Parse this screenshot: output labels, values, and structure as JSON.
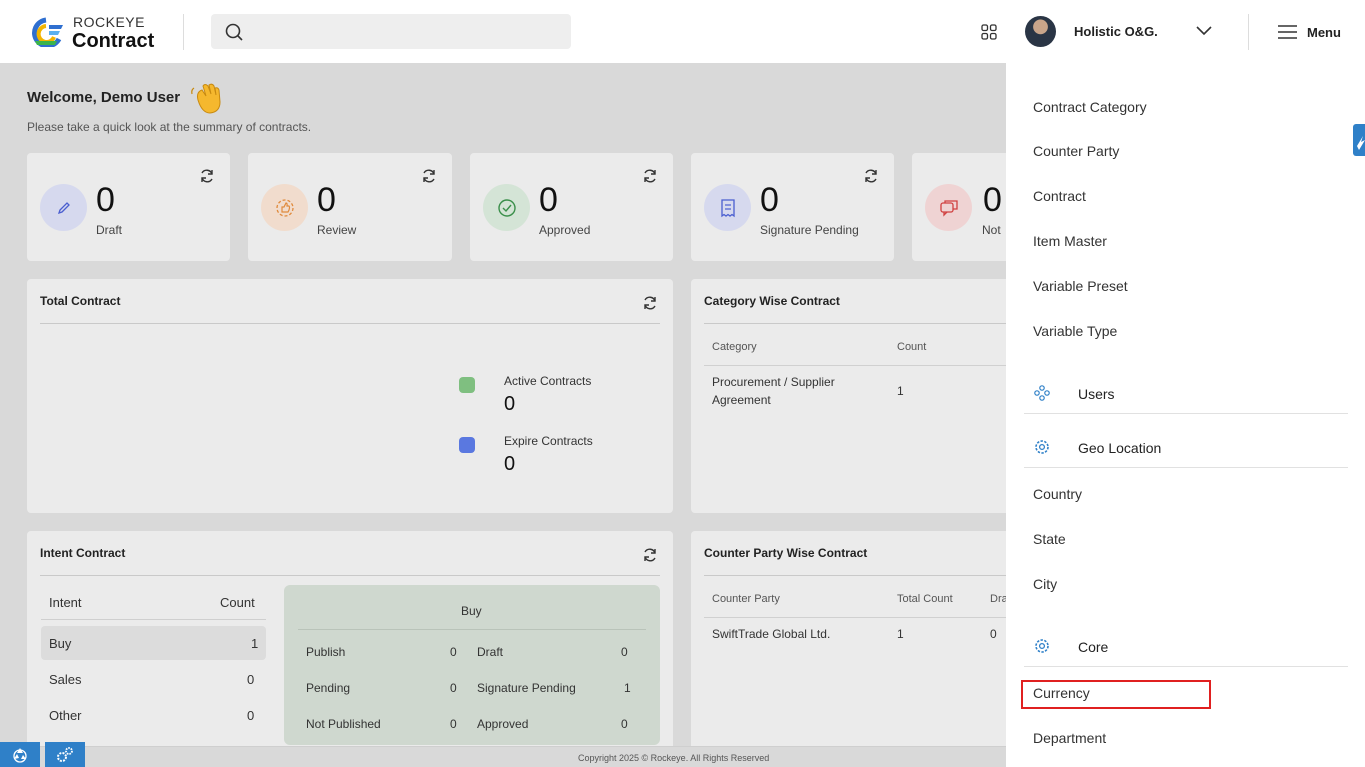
{
  "header": {
    "logo_top": "ROCKEYE",
    "logo_bottom": "Contract",
    "search_placeholder": "",
    "org_name": "Holistic O&G.",
    "menu_label": "Menu"
  },
  "welcome": {
    "title": "Welcome, Demo User",
    "subtitle": "Please take a quick look at the summary of contracts."
  },
  "stats": [
    {
      "value": "0",
      "label": "Draft",
      "icon": "pencil-icon",
      "color": "#d6d9ee"
    },
    {
      "value": "0",
      "label": "Review",
      "icon": "thumbs-up-icon",
      "color": "#f1dccd"
    },
    {
      "value": "0",
      "label": "Approved",
      "icon": "check-circle-icon",
      "color": "#d4e4d6"
    },
    {
      "value": "0",
      "label": "Signature Pending",
      "icon": "receipt-icon",
      "color": "#d6d9ee"
    },
    {
      "value": "0",
      "label": "Not",
      "icon": "chat-icon",
      "color": "#efd3d3"
    }
  ],
  "total_contract": {
    "title": "Total Contract",
    "active_label": "Active Contracts",
    "active_value": "0",
    "expire_label": "Expire Contracts",
    "expire_value": "0",
    "active_color": "#7fbf80",
    "expire_color": "#5a78e0"
  },
  "category_contract": {
    "title": "Category Wise Contract",
    "headers": [
      "Category",
      "Count"
    ],
    "rows": [
      {
        "category_line1": "Procurement / Supplier",
        "category_line2": "Agreement",
        "count": "1"
      }
    ]
  },
  "intent_contract": {
    "title": "Intent Contract",
    "headers": [
      "Intent",
      "Count"
    ],
    "rows": [
      {
        "intent": "Buy",
        "count": "1"
      },
      {
        "intent": "Sales",
        "count": "0"
      },
      {
        "intent": "Other",
        "count": "0"
      }
    ],
    "buy_title": "Buy",
    "buy_items": [
      {
        "label": "Publish",
        "value": "0"
      },
      {
        "label": "Draft",
        "value": "0"
      },
      {
        "label": "Pending",
        "value": "0"
      },
      {
        "label": "Signature Pending",
        "value": "1"
      },
      {
        "label": "Not Published",
        "value": "0"
      },
      {
        "label": "Approved",
        "value": "0"
      }
    ]
  },
  "counter_party_contract": {
    "title": "Counter Party Wise Contract",
    "headers": [
      "Counter Party",
      "Total Count",
      "Dra"
    ],
    "rows": [
      {
        "party": "SwiftTrade Global Ltd.",
        "total": "1",
        "draft": "0"
      }
    ]
  },
  "footer": {
    "copyright": "Copyright 2025 © Rockeye. All Rights Reserved"
  },
  "menu": {
    "items_top": [
      "Contract Category",
      "Counter Party",
      "Contract",
      "Item Master",
      "Variable Preset",
      "Variable Type"
    ],
    "section_users": "Users",
    "section_geo": "Geo Location",
    "geo_items": [
      "Country",
      "State",
      "City"
    ],
    "section_core": "Core",
    "core_items": [
      "Currency",
      "Department"
    ]
  }
}
